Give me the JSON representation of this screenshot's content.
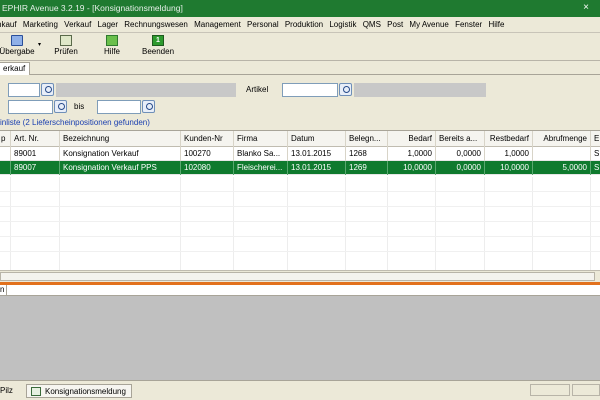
{
  "window": {
    "title": "EPHIR Avenue 3.2.19 - [Konsignationsmeldung]",
    "close_glyph": "×"
  },
  "menu": [
    "nkauf",
    "Marketing",
    "Verkauf",
    "Lager",
    "Rechnungswesen",
    "Management",
    "Personal",
    "Produktion",
    "Logistik",
    "QMS",
    "Post",
    "My Avenue",
    "Fenster",
    "Hilfe"
  ],
  "toolbar": {
    "upload_label": "Übergabe",
    "check_label": "Prüfen",
    "help_label": "Hilfe",
    "exit_label": "Beenden",
    "exit_glyph": "1",
    "caret": "▾"
  },
  "tabs": [
    "erkauf"
  ],
  "filters": {
    "artikel_label": "Artikel",
    "bis_label": "bis",
    "field1": "",
    "artikel_value": "",
    "date_from": "",
    "date_to": ""
  },
  "result_text": "inliste (2 Lieferscheinpositionen gefunden)",
  "grid": {
    "columns": [
      "p",
      "Art. Nr.",
      "Bezeichnung",
      "Kunden-Nr",
      "Firma",
      "Datum",
      "Belegn...",
      "Bedarf",
      "Bereits a...",
      "Restbedarf",
      "Abrufmenge",
      "E"
    ],
    "rows": [
      {
        "p": "",
        "art_nr": "89001",
        "bezeichnung": "Konsignation Verkauf",
        "kunden_nr": "100270",
        "firma": "Blanko Sa...",
        "datum": "13.01.2015",
        "beleg": "1268",
        "bedarf": "1,0000",
        "bereits": "0,0000",
        "restbedarf": "1,0000",
        "abrufmenge": "",
        "e": "S",
        "selected": false
      },
      {
        "p": "",
        "art_nr": "89007",
        "bezeichnung": "Konsignation Verkauf PPS",
        "kunden_nr": "102080",
        "firma": "Fleischerei...",
        "datum": "13.01.2015",
        "beleg": "1269",
        "bedarf": "10,0000",
        "bereits": "0,0000",
        "restbedarf": "10,0000",
        "abrufmenge": "5,0000",
        "e": "S",
        "selected": true
      }
    ]
  },
  "detail_title": "n",
  "statusbar": {
    "pilz": "Pilz",
    "task": "Konsignationsmeldung"
  },
  "colors": {
    "title_bg": "#1f7a30",
    "selection": "#0f7a2e",
    "accent_bar": "#e2711d",
    "result_text": "#1a3fb0"
  }
}
